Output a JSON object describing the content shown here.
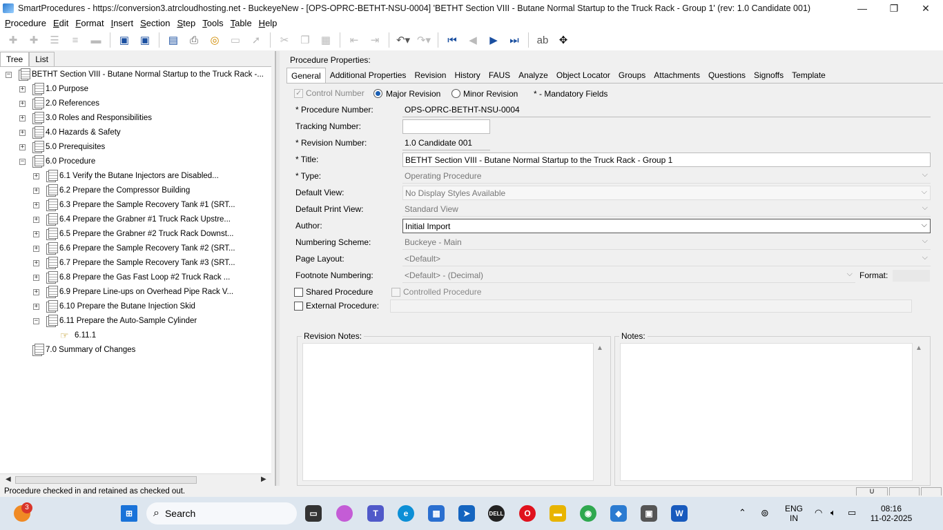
{
  "window": {
    "title": "SmartProcedures - https://conversion3.atrcloudhosting.net - BuckeyeNew - [OPS-OPRC-BETHT-NSU-0004] 'BETHT Section VIII - Butane Normal Startup to the Truck Rack - Group 1' (rev: 1.0 Candidate 001)",
    "minimize_glyph": "—",
    "maximize_glyph": "❐",
    "close_glyph": "✕"
  },
  "menu": {
    "procedure": "rocedure",
    "procedure_key": "P",
    "edit": "dit",
    "edit_key": "E",
    "format": "ormat",
    "format_key": "F",
    "insert": "nsert",
    "insert_key": "I",
    "section": "ection",
    "section_key": "S",
    "step": "tep",
    "step_key": "S",
    "tools": "ools",
    "tools_key": "T",
    "table": "able",
    "table_key": "T",
    "help": "elp",
    "help_key": "H"
  },
  "left_tabs": {
    "tree": "Tree",
    "list": "List"
  },
  "tree": {
    "root": "BETHT Section VIII - Butane Normal Startup to the Truck Rack -...",
    "items": [
      "1.0 Purpose",
      "2.0 References",
      "3.0 Roles and Responsibilities",
      "4.0 Hazards & Safety",
      "5.0 Prerequisites",
      "6.0 Procedure",
      "6.1 Verify the Butane Injectors are Disabled...",
      "6.2 Prepare the Compressor Building",
      "6.3 Prepare the Sample Recovery Tank #1 (SRT...",
      "6.4 Prepare the Grabner #1 Truck Rack Upstre...",
      "6.5 Prepare the Grabner #2 Truck Rack Downst...",
      "6.6 Prepare the Sample Recovery Tank #2 (SRT...",
      "6.7 Prepare the Sample Recovery Tank #3 (SRT...",
      "6.8 Prepare the Gas Fast Loop #2 Truck Rack ...",
      "6.9 Prepare Line-ups on Overhead Pipe Rack V...",
      "6.10 Prepare the Butane Injection Skid",
      "6.11 Prepare the Auto-Sample Cylinder",
      "6.11.1",
      "7.0 Summary of Changes"
    ],
    "plus": "+",
    "minus": "−"
  },
  "props": {
    "heading": "Procedure Properties:",
    "tabs": [
      "General",
      "Additional Properties",
      "Revision",
      "History",
      "FAUS",
      "Analyze",
      "Object Locator",
      "Groups",
      "Attachments",
      "Questions",
      "Signoffs",
      "Template"
    ],
    "control_number": "Control Number",
    "major_revision": "Major Revision",
    "minor_revision": "Minor Revision",
    "mandatory": "* - Mandatory Fields",
    "procedure_number_label": "* Procedure Number:",
    "procedure_number": "OPS-OPRC-BETHT-NSU-0004",
    "tracking_number_label": "Tracking Number:",
    "tracking_number": "",
    "revision_number_label": "* Revision Number:",
    "revision_number": "1.0 Candidate 001",
    "title_label": "* Title:",
    "title": "BETHT Section VIII - Butane Normal Startup to the Truck Rack - Group 1",
    "type_label": "* Type:",
    "type": "Operating Procedure",
    "default_view_label": "Default View:",
    "default_view": "No Display Styles Available",
    "default_print_view_label": "Default Print View:",
    "default_print_view": "Standard View",
    "author_label": "Author:",
    "author": "Initial Import",
    "numbering_scheme_label": "Numbering Scheme:",
    "numbering_scheme": "Buckeye - Main",
    "page_layout_label": "Page Layout:",
    "page_layout": "<Default>",
    "footnote_label": "Footnote Numbering:",
    "footnote": "<Default> - (Decimal)",
    "format_label": "Format:",
    "shared_procedure": "Shared Procedure",
    "controlled_procedure": "Controlled Procedure",
    "external_procedure": "External Procedure:",
    "revision_notes": "Revision Notes:",
    "notes": "Notes:",
    "chevron": "⌵"
  },
  "status": {
    "message": "Procedure checked in and retained as checked out.",
    "pane": "U"
  },
  "taskbar": {
    "search": "Search",
    "notification_count": "3",
    "lang": "ENG",
    "region": "IN",
    "time": "08:16",
    "date": "11-02-2025"
  }
}
